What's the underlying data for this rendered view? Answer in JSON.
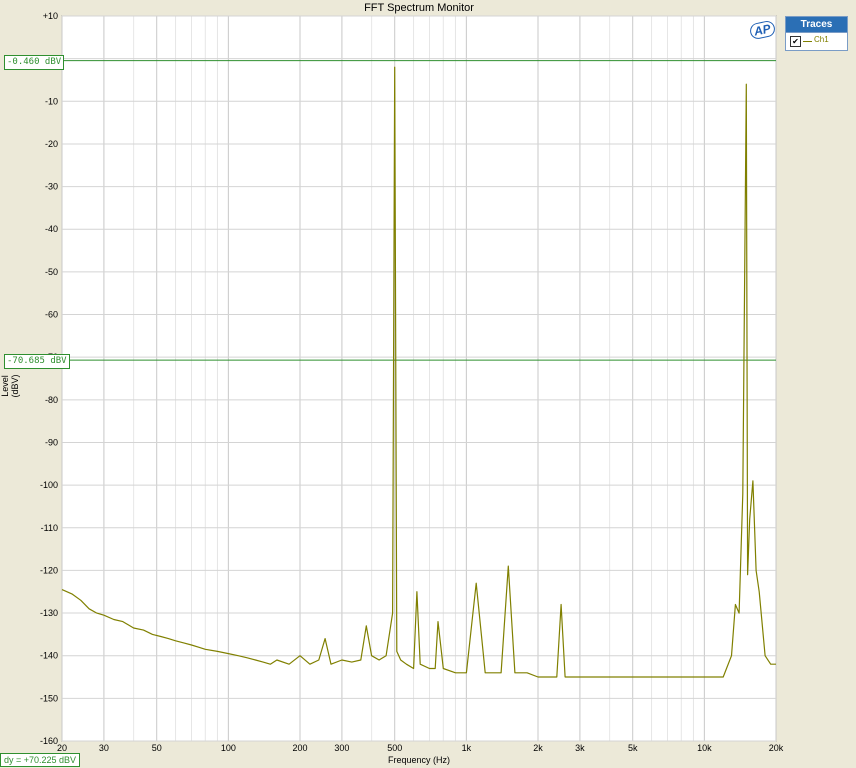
{
  "window": {
    "title": "FFT Spectrum Monitor"
  },
  "legend": {
    "header": "Traces",
    "items": [
      {
        "label": "Ch1",
        "checked": true,
        "color": "#808000"
      }
    ]
  },
  "cursors": {
    "upper_label": "-0.460 dBV",
    "lower_label": "-70.685 dBV",
    "dy_label": "dy = +70.225 dBV",
    "color": "#2f8f2f"
  },
  "logo": {
    "text": "AP"
  },
  "chart_data": {
    "type": "line",
    "title": "FFT Spectrum Monitor",
    "xlabel": "Frequency (Hz)",
    "ylabel": "Level (dBV)",
    "xscale": "log",
    "xlim": [
      20,
      20000
    ],
    "ylim": [
      -160,
      10
    ],
    "grid": true,
    "legend_position": "top-right",
    "x_tick_values": [
      20,
      30,
      50,
      100,
      200,
      300,
      500,
      1000,
      2000,
      3000,
      5000,
      10000,
      20000
    ],
    "x_tick_labels": [
      "20",
      "30",
      "50",
      "100",
      "200",
      "300",
      "500",
      "1k",
      "2k",
      "3k",
      "5k",
      "10k",
      "20k"
    ],
    "y_tick_values": [
      10,
      0,
      -10,
      -20,
      -30,
      -40,
      -50,
      -60,
      -70,
      -80,
      -90,
      -100,
      -110,
      -120,
      -130,
      -140,
      -150,
      -160
    ],
    "y_tick_labels": [
      "+10",
      "0",
      "-10",
      "-20",
      "-30",
      "-40",
      "-50",
      "-60",
      "-70",
      "-80",
      "-90",
      "-100",
      "-110",
      "-120",
      "-130",
      "-140",
      "-150",
      "-160"
    ],
    "cursor_levels": [
      -0.46,
      -70.685
    ],
    "series": [
      {
        "name": "Ch1",
        "color": "#808000",
        "x": [
          20,
          22,
          24,
          26,
          28,
          30,
          33,
          36,
          40,
          44,
          48,
          52,
          56,
          60,
          65,
          70,
          75,
          80,
          90,
          100,
          110,
          120,
          130,
          140,
          150,
          160,
          180,
          200,
          220,
          240,
          255,
          270,
          300,
          330,
          360,
          380,
          400,
          430,
          460,
          490,
          500,
          510,
          530,
          560,
          600,
          620,
          640,
          700,
          740,
          760,
          800,
          900,
          1000,
          1100,
          1200,
          1400,
          1500,
          1600,
          1800,
          2000,
          2400,
          2500,
          2600,
          3000,
          4000,
          5000,
          6000,
          8000,
          10000,
          12000,
          13000,
          13500,
          14000,
          14500,
          15000,
          15200,
          15500,
          16000,
          16500,
          17000,
          18000,
          19000,
          20000
        ],
        "y": [
          -124.5,
          -125.5,
          -127,
          -129,
          -130,
          -130.5,
          -131.5,
          -132,
          -133.5,
          -134,
          -135,
          -135.5,
          -136,
          -136.5,
          -137,
          -137.5,
          -138,
          -138.5,
          -139,
          -139.5,
          -140,
          -140.5,
          -141,
          -141.5,
          -142,
          -141,
          -142,
          -140,
          -142,
          -141,
          -136,
          -142,
          -141,
          -141.5,
          -141,
          -133,
          -140,
          -141,
          -140,
          -130,
          -2,
          -139,
          -141,
          -142,
          -143,
          -125,
          -142,
          -143,
          -143,
          -132,
          -143,
          -144,
          -144,
          -123,
          -144,
          -144,
          -119,
          -144,
          -144,
          -145,
          -145,
          -128,
          -145,
          -145,
          -145,
          -145,
          -145,
          -145,
          -145,
          -145,
          -140,
          -128,
          -130,
          -102,
          -6,
          -121,
          -108,
          -99,
          -120,
          -125,
          -140,
          -142,
          -142
        ]
      }
    ]
  }
}
